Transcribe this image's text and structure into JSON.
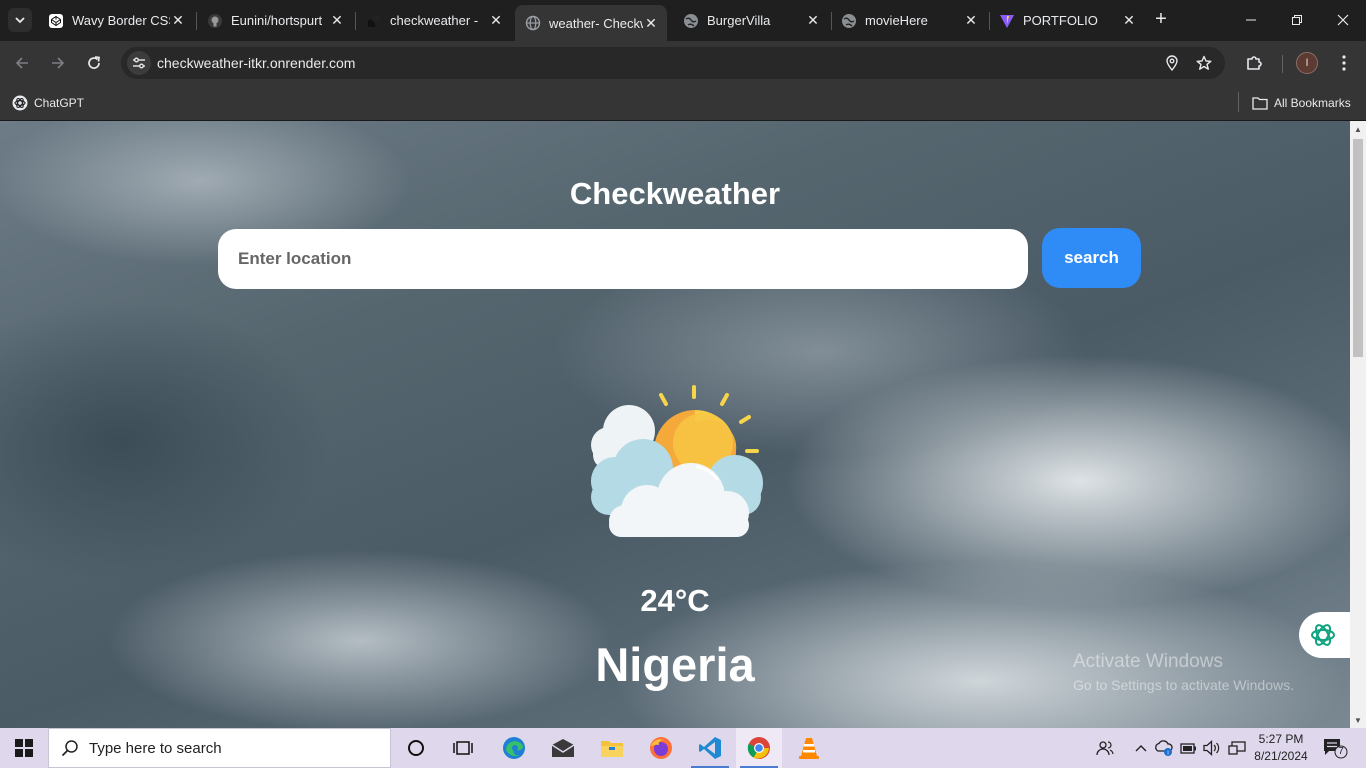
{
  "browser": {
    "tabs": [
      {
        "title": "Wavy Border CSS",
        "icon": "codepen-icon"
      },
      {
        "title": "Eunini/hortspurt",
        "icon": "github-icon"
      },
      {
        "title": "checkweather - ",
        "icon": "render-icon"
      },
      {
        "title": "weather- Checkw",
        "icon": "globe-icon",
        "active": true
      },
      {
        "title": "BurgerVilla",
        "icon": "globe-icon"
      },
      {
        "title": "movieHere",
        "icon": "globe-icon"
      },
      {
        "title": "PORTFOLIO",
        "icon": "vite-icon"
      }
    ],
    "url": "checkweather-itkr.onrender.com",
    "profile_initial": "I",
    "bookmarks": [
      {
        "label": "ChatGPT",
        "icon": "chatgpt-icon"
      }
    ],
    "all_bookmarks_label": "All Bookmarks"
  },
  "page": {
    "title": "Checkweather",
    "search_placeholder": "Enter location",
    "search_button": "search",
    "weather_icon": "partly-cloudy-sun-icon",
    "temperature": "24°C",
    "location": "Nigeria"
  },
  "overlay": {
    "activate_title": "Activate Windows",
    "activate_sub": "Go to Settings to activate Windows."
  },
  "taskbar": {
    "search_placeholder": "Type here to search",
    "apps": [
      "cortana-icon",
      "task-view-icon",
      "edge-icon",
      "mail-icon",
      "file-explorer-icon",
      "firefox-icon",
      "vscode-icon",
      "chrome-icon",
      "vlc-icon"
    ],
    "time": "5:27 PM",
    "date": "8/21/2024",
    "notification_count": "7"
  },
  "colors": {
    "search_button": "#2f8cf6",
    "browser_dark": "#202124",
    "taskbar": "#dfd8ec"
  }
}
